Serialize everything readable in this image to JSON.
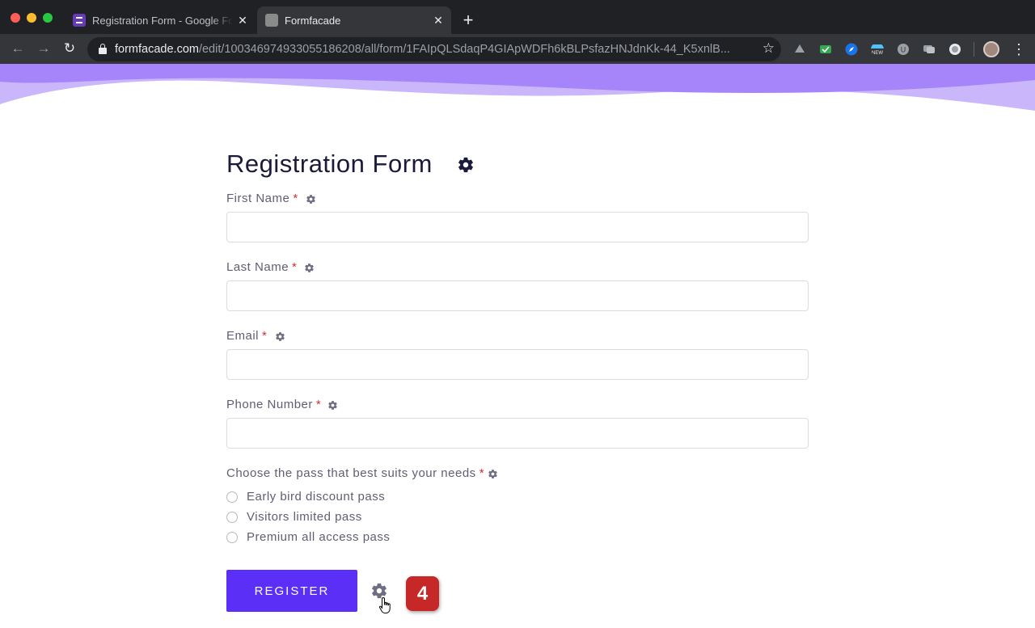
{
  "browser": {
    "tabs": [
      {
        "title": "Registration Form - Google Forms",
        "active": false
      },
      {
        "title": "Formfacade",
        "active": true
      }
    ],
    "new_tab_label": "+",
    "close_label": "✕",
    "url_host": "formfacade.com",
    "url_path": "/edit/100346974933055186208/all/form/1FAIpQLSdaqP4GIApWDFh6kBLPsfazHNJdnKk-44_K5xnlB...",
    "extensions": [
      "drive-icon",
      "mail-check-icon",
      "compass-icon",
      "new-badge-icon",
      "u-icon",
      "chat-icon",
      "circle-icon"
    ]
  },
  "form": {
    "title": "Registration Form",
    "fields": [
      {
        "label": "First Name",
        "required_mark": "*",
        "value": ""
      },
      {
        "label": "Last Name",
        "required_mark": "*",
        "value": ""
      },
      {
        "label": "Email",
        "required_mark": "*",
        "value": ""
      },
      {
        "label": "Phone Number",
        "required_mark": "*",
        "value": ""
      }
    ],
    "choice": {
      "label": "Choose the pass that best suits your needs",
      "required_mark": "*",
      "options": [
        "Early bird discount pass",
        "Visitors limited pass",
        "Premium all access pass"
      ]
    },
    "submit_label": "REGISTER",
    "step_badge": "4"
  },
  "colors": {
    "accent": "#5b2ff5",
    "banner": "#a685fa",
    "badge": "#c62828"
  }
}
